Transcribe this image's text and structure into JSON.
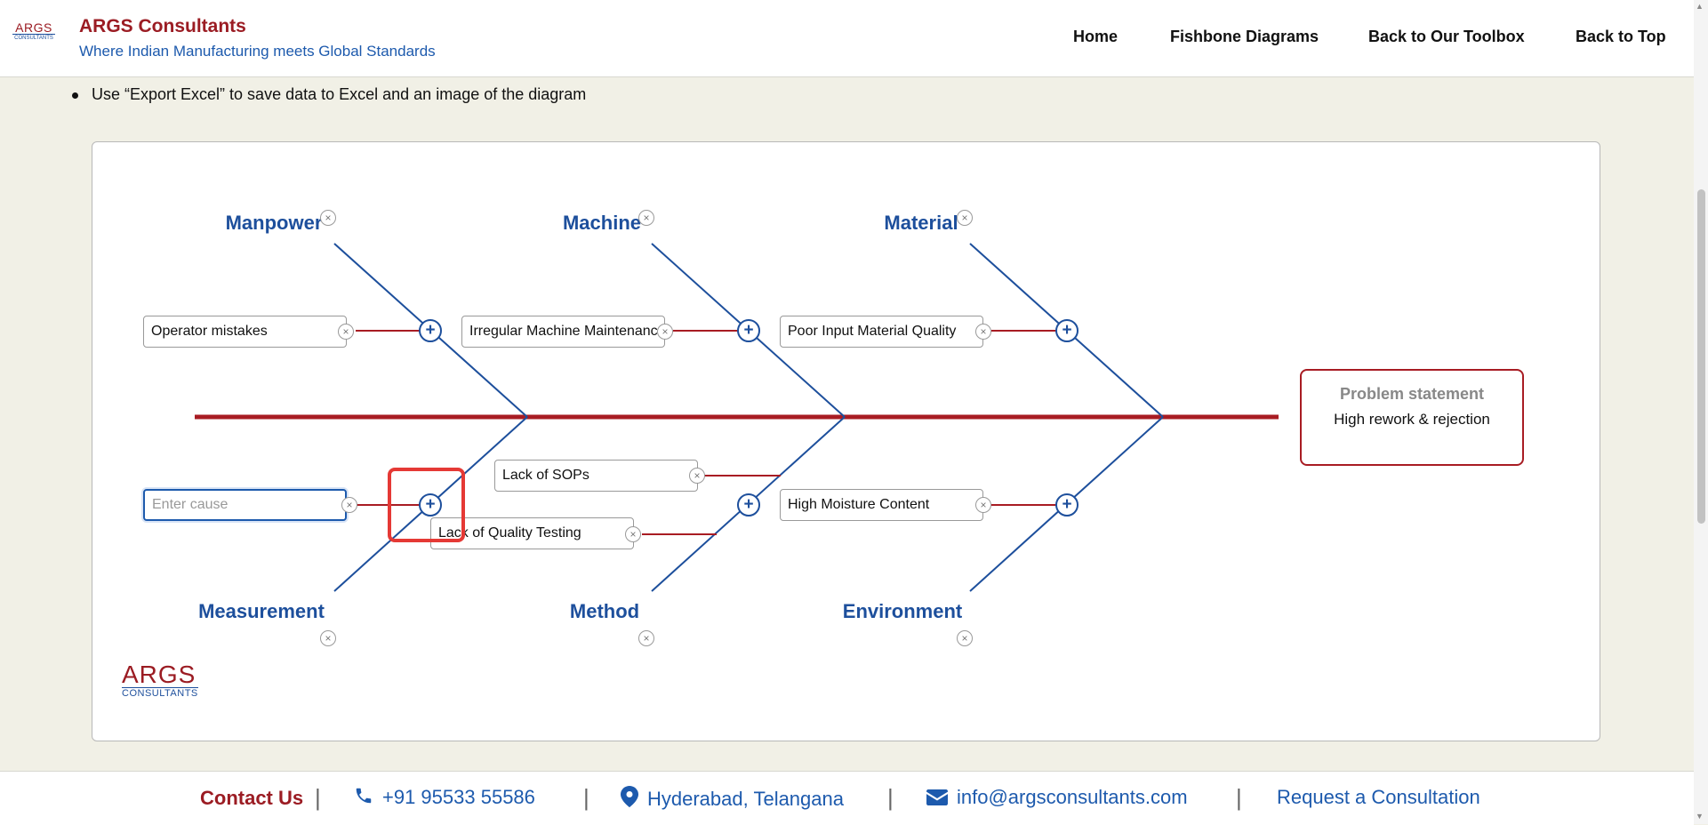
{
  "header": {
    "logo_big": "ARGS",
    "logo_small": "CONSULTANTS",
    "title": "ARGS Consultants",
    "tagline": "Where Indian Manufacturing meets Global Standards",
    "nav": [
      "Home",
      "Fishbone Diagrams",
      "Back to Our Toolbox",
      "Back to Top"
    ]
  },
  "instructions": {
    "bullet": "Use “Export Excel” to save data to Excel and an image of the diagram"
  },
  "diagram": {
    "categories": {
      "manpower": "Manpower",
      "machine": "Machine",
      "material": "Material",
      "measurement": "Measurement",
      "method": "Method",
      "environment": "Environment"
    },
    "causes": {
      "manpower_1": "Operator mistakes",
      "machine_1": "Irregular Machine Maintenance",
      "material_1": "Poor Input Material Quality",
      "measurement_1_placeholder": "Enter cause",
      "measurement_2": "Lack of Quality Testing",
      "method_1": "Lack of SOPs",
      "environment_1": "High Moisture Content"
    },
    "remove_symbol": "×",
    "add_symbol": "+",
    "problem_label": "Problem statement",
    "problem_text": "High rework & rejection",
    "logo_big": "ARGS",
    "logo_small": "CONSULTANTS",
    "colors": {
      "spine": "#a81c23",
      "bone": "#1d4f9c",
      "cause_line": "#a81c23"
    }
  },
  "footer": {
    "contact": "Contact Us",
    "phone": "+91 95533 55586",
    "location": "Hyderabad, Telangana",
    "email": "info@argsconsultants.com",
    "consult": "Request a Consultation",
    "separator": "|"
  }
}
